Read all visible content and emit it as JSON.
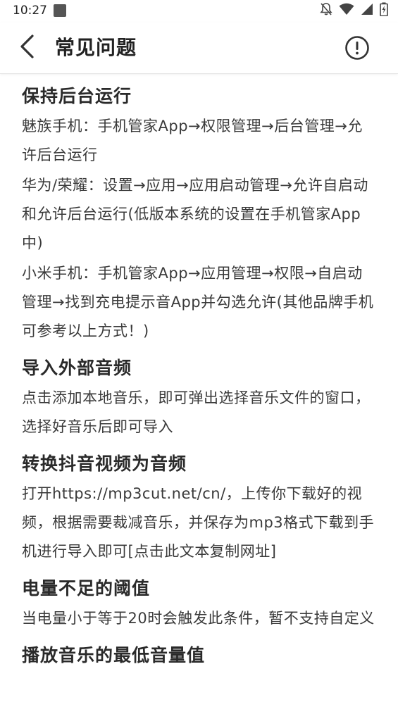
{
  "status_bar": {
    "time": "10:27",
    "icons": [
      "notif-square-icon",
      "mute-bell-icon",
      "wifi-icon",
      "signal-icon",
      "battery-charging-icon"
    ]
  },
  "app_bar": {
    "title": "常见问题",
    "back_icon": "chevron-left-icon",
    "info_icon": "info-circle-icon"
  },
  "faq": [
    {
      "title": "保持后台运行",
      "paragraphs": [
        "魅族手机：手机管家App→权限管理→后台管理→允许后台运行",
        "华为/荣耀：设置→应用→应用启动管理→允许自启动和允许后台运行(低版本系统的设置在手机管家App中)",
        "小米手机：手机管家App→应用管理→权限→自启动管理→找到充电提示音App并勾选允许(其他品牌手机可参考以上方式！)"
      ]
    },
    {
      "title": "导入外部音频",
      "paragraphs": [
        "点击添加本地音乐，即可弹出选择音乐文件的窗口，选择好音乐后即可导入"
      ]
    },
    {
      "title": "转换抖音视频为音频",
      "paragraphs": [
        "打开https://mp3cut.net/cn/，上传你下载好的视频，根据需要裁减音乐，并保存为mp3格式下载到手机进行导入即可[点击此文本复制网址]"
      ]
    },
    {
      "title": "电量不足的阈值",
      "paragraphs": [
        "当电量小于等于20时会触发此条件，暂不支持自定义"
      ]
    },
    {
      "title": "播放音乐的最低音量值",
      "paragraphs": []
    }
  ]
}
